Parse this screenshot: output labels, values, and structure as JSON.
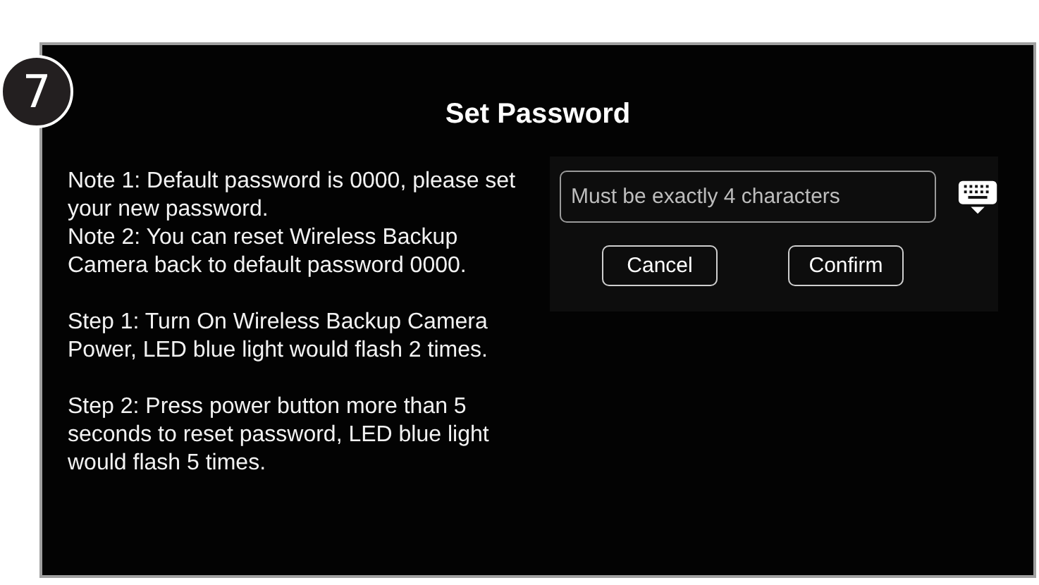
{
  "step_badge": "7",
  "title": "Set Password",
  "instruction_groups": [
    {
      "paragraphs": [
        "Note 1: Default password is 0000, please set your new password.",
        "Note 2: You can reset Wireless Backup Camera back to default password 0000."
      ]
    },
    {
      "paragraphs": [
        "Step 1: Turn On Wireless Backup Camera Power, LED blue light would flash 2 times."
      ]
    },
    {
      "paragraphs": [
        "Step 2: Press power button more than 5 seconds to reset password, LED blue light would flash 5 times."
      ]
    }
  ],
  "password_field": {
    "placeholder": "Must be exactly 4 characters"
  },
  "buttons": [
    "Cancel",
    "Confirm"
  ]
}
